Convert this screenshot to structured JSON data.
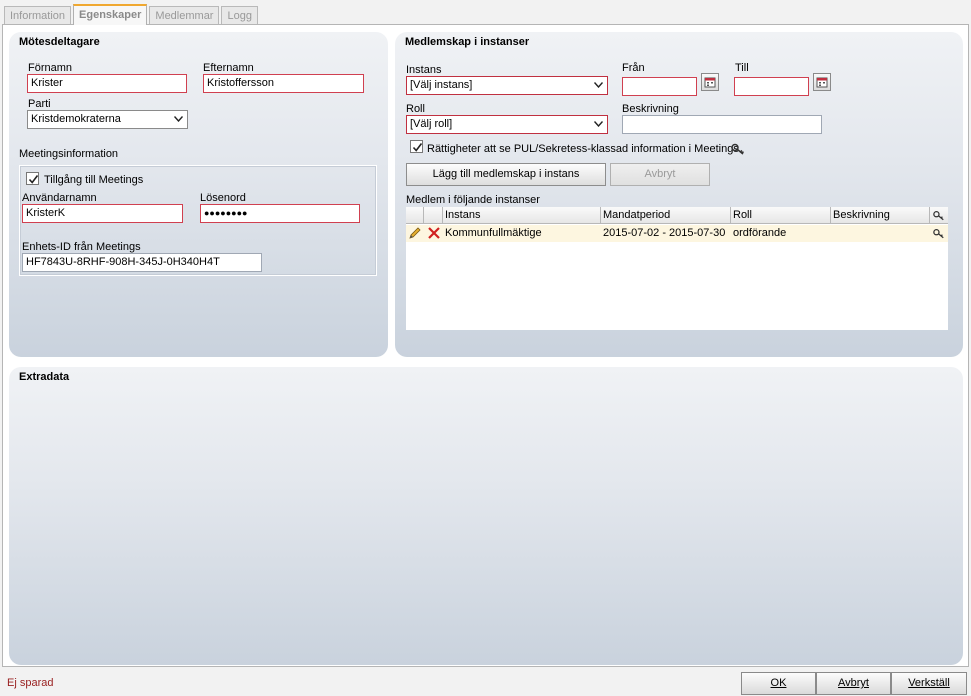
{
  "tabs": [
    {
      "label": "Information"
    },
    {
      "label": "Egenskaper"
    },
    {
      "label": "Medlemmar"
    },
    {
      "label": "Logg"
    }
  ],
  "participant": {
    "title": "Mötesdeltagare",
    "first_name_label": "Förnamn",
    "first_name_value": "Krister",
    "last_name_label": "Efternamn",
    "last_name_value": "Kristoffersson",
    "party_label": "Parti",
    "party_value": "Kristdemokraterna",
    "meetings_section_title": "Meetingsinformation",
    "access_label": "Tillgång till Meetings",
    "access_checked": true,
    "username_label": "Användarnamn",
    "username_value": "KristerK",
    "password_label": "Lösenord",
    "password_value": "●●●●●●●●",
    "unit_id_label": "Enhets-ID från Meetings",
    "unit_id_value": "HF7843U-8RHF-908H-345J-0H340H4T"
  },
  "membership": {
    "title": "Medlemskap i instanser",
    "instance_label": "Instans",
    "instance_value": "[Välj instans]",
    "from_label": "Från",
    "to_label": "Till",
    "role_label": "Roll",
    "role_value": "[Välj roll]",
    "description_label": "Beskrivning",
    "rights_label": "Rättigheter att se PUL/Sekretess-klassad information i Meetings",
    "rights_checked": true,
    "add_button": "Lägg till medlemskap i instans",
    "cancel_button": "Avbryt",
    "list_title": "Medlem i följande instanser",
    "columns": [
      "Instans",
      "Mandatperiod",
      "Roll",
      "Beskrivning"
    ],
    "rows": [
      {
        "instans": "Kommunfullmäktige",
        "mandatperiod": "2015-07-02 - 2015-07-30",
        "roll": "ordförande",
        "beskrivning": ""
      }
    ]
  },
  "extradata": {
    "title": "Extradata"
  },
  "status": {
    "text": "Ej sparad"
  },
  "footer": {
    "ok": "OK",
    "cancel": "Avbryt",
    "apply": "Verkställ"
  },
  "colors": {
    "accent_tab": "#f0a830",
    "required_border": "#d04050",
    "status_text": "#9a2222",
    "row_highlight": "#fdf6e0"
  }
}
